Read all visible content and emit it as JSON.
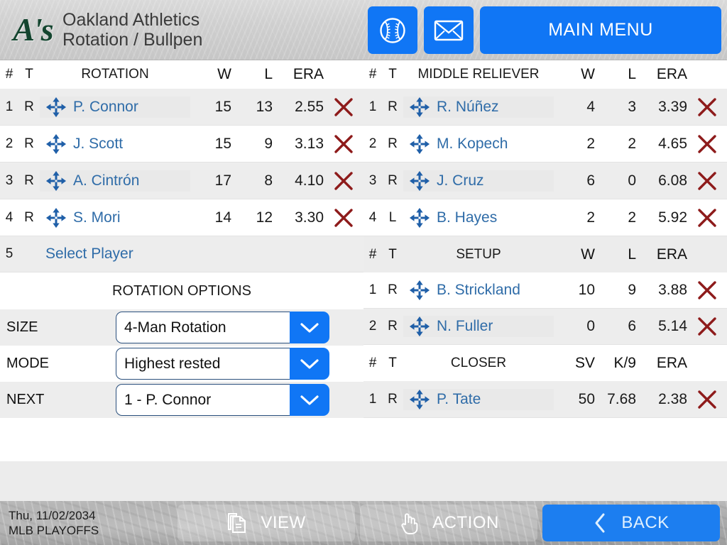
{
  "header": {
    "logo_text": "A's",
    "logo_name": "athletics-logo",
    "team_title": "Oakland Athletics",
    "page_title": "Rotation / Bullpen",
    "baseball_button": "baseball-icon",
    "mail_button": "mail-icon",
    "main_menu_label": "MAIN MENU",
    "accent_blue": "#1076f5"
  },
  "rotation": {
    "headers": {
      "num": "#",
      "throws": "T",
      "name": "ROTATION",
      "w": "W",
      "l": "L",
      "era": "ERA"
    },
    "rows": [
      {
        "num": "1",
        "t": "R",
        "name": "P. Connor",
        "w": "15",
        "l": "13",
        "era": "2.55"
      },
      {
        "num": "2",
        "t": "R",
        "name": "J. Scott",
        "w": "15",
        "l": "9",
        "era": "3.13"
      },
      {
        "num": "3",
        "t": "R",
        "name": "A. Cintrón",
        "w": "17",
        "l": "8",
        "era": "4.10"
      },
      {
        "num": "4",
        "t": "R",
        "name": "S. Mori",
        "w": "14",
        "l": "12",
        "era": "3.30"
      }
    ],
    "empty_slot": {
      "num": "5",
      "label": "Select Player"
    }
  },
  "rotation_options": {
    "title": "ROTATION OPTIONS",
    "fields": [
      {
        "label": "SIZE",
        "value": "4-Man Rotation"
      },
      {
        "label": "MODE",
        "value": "Highest rested"
      },
      {
        "label": "NEXT",
        "value": "1 - P. Connor"
      }
    ]
  },
  "middle_reliever": {
    "headers": {
      "num": "#",
      "throws": "T",
      "name": "MIDDLE RELIEVER",
      "w": "W",
      "l": "L",
      "era": "ERA"
    },
    "rows": [
      {
        "num": "1",
        "t": "R",
        "name": "R. Núñez",
        "w": "4",
        "l": "3",
        "era": "3.39"
      },
      {
        "num": "2",
        "t": "R",
        "name": "M. Kopech",
        "w": "2",
        "l": "2",
        "era": "4.65"
      },
      {
        "num": "3",
        "t": "R",
        "name": "J. Cruz",
        "w": "6",
        "l": "0",
        "era": "6.08"
      },
      {
        "num": "4",
        "t": "L",
        "name": "B. Hayes",
        "w": "2",
        "l": "2",
        "era": "5.92"
      }
    ]
  },
  "setup": {
    "headers": {
      "num": "#",
      "throws": "T",
      "name": "SETUP",
      "w": "W",
      "l": "L",
      "era": "ERA"
    },
    "rows": [
      {
        "num": "1",
        "t": "R",
        "name": "B. Strickland",
        "w": "10",
        "l": "9",
        "era": "3.88"
      },
      {
        "num": "2",
        "t": "R",
        "name": "N. Fuller",
        "w": "0",
        "l": "6",
        "era": "5.14"
      }
    ]
  },
  "closer": {
    "headers": {
      "num": "#",
      "throws": "T",
      "name": "CLOSER",
      "sv": "SV",
      "k9": "K/9",
      "era": "ERA"
    },
    "rows": [
      {
        "num": "1",
        "t": "R",
        "name": "P. Tate",
        "sv": "50",
        "k9": "7.68",
        "era": "2.38"
      }
    ]
  },
  "footer": {
    "date": "Thu, 11/02/2034",
    "league": "MLB PLAYOFFS",
    "view_label": "VIEW",
    "action_label": "ACTION",
    "back_label": "BACK"
  },
  "icons": {
    "move": "move-icon",
    "remove": "remove-x-icon",
    "dropdown": "chevron-down-icon",
    "view": "document-copy-icon",
    "action": "hand-pointer-icon",
    "back": "chevron-left-icon"
  },
  "colors": {
    "link": "#2f6ca8",
    "remove_x": "#8e1b1b",
    "row_alt": "#ededed",
    "logo_green": "#14452F"
  }
}
